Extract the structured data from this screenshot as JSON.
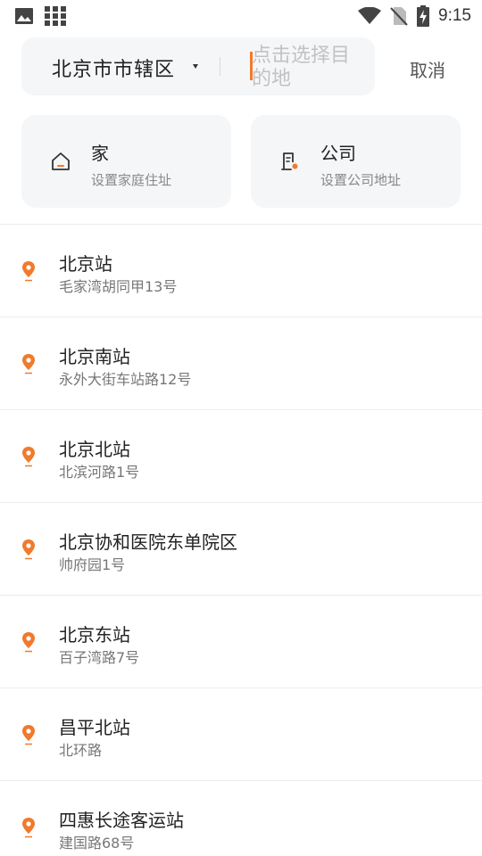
{
  "status_bar": {
    "time": "9:15",
    "icons": [
      "image-icon",
      "grid-icon",
      "wifi-icon",
      "no-sim-icon",
      "battery-charging-icon"
    ]
  },
  "search": {
    "city": "北京市市辖区",
    "placeholder": "点击选择目的地",
    "cancel_label": "取消"
  },
  "shortcuts": {
    "home": {
      "title": "家",
      "subtitle": "设置家庭住址",
      "icon": "home-icon"
    },
    "office": {
      "title": "公司",
      "subtitle": "设置公司地址",
      "icon": "office-building-icon"
    }
  },
  "accent_color": "#f07a2d",
  "places": [
    {
      "name": "北京站",
      "address": "毛家湾胡同甲13号"
    },
    {
      "name": "北京南站",
      "address": "永外大街车站路12号"
    },
    {
      "name": "北京北站",
      "address": "北滨河路1号"
    },
    {
      "name": "北京协和医院东单院区",
      "address": "帅府园1号"
    },
    {
      "name": "北京东站",
      "address": "百子湾路7号"
    },
    {
      "name": "昌平北站",
      "address": "北环路"
    },
    {
      "name": "四惠长途客运站",
      "address": "建国路68号"
    }
  ]
}
